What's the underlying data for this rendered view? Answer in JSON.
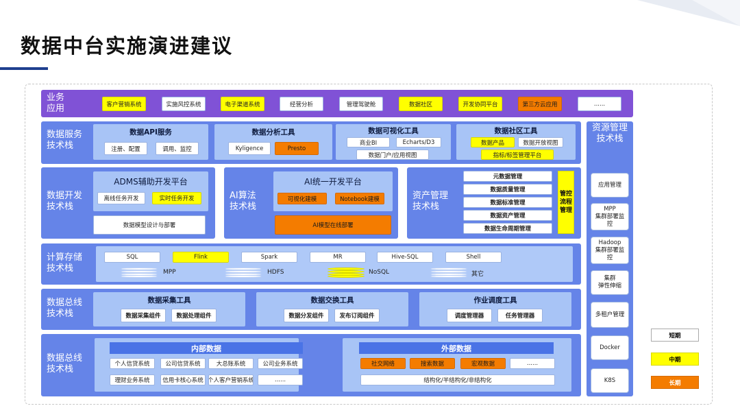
{
  "title": "数据中台实施演进建议",
  "colors": {
    "band": "#6584e8",
    "purple": "#8052d6",
    "inner": "#a8c4f6",
    "yellow": "#ffff00",
    "orange": "#f47c00",
    "bar": "#4a73e6"
  },
  "app_layer": {
    "label": "业务\n应用",
    "chips": [
      "客户营销系统",
      "实施风控系统",
      "电子渠道系统",
      "经营分析",
      "管理驾驶舱",
      "数据社区",
      "开发协同平台",
      "第三方云应用",
      "......"
    ]
  },
  "service_layer": {
    "label": "数据服务\n技术栈",
    "groups": [
      {
        "title": "数据API服务",
        "chips": [
          "注册、配置",
          "调用、监控"
        ]
      },
      {
        "title": "数据分析工具",
        "chips": [
          "Kyligence",
          "Presto"
        ]
      },
      {
        "title": "数据可视化工具",
        "chips": [
          "商业BI",
          "Echarts/D3",
          "数据门户/应用视图"
        ]
      },
      {
        "title": "数据社区工具",
        "chips": [
          "数据产品",
          "数据开放视图",
          "指标/标签管理平台"
        ]
      }
    ]
  },
  "resource": {
    "label": "资源管理\n技术栈",
    "chips": [
      "应用管理",
      "MPP\n集群部署监控",
      "Hadoop\n集群部署监控",
      "集群\n弹性伸缩",
      "多租户管理",
      "Docker",
      "K8S"
    ]
  },
  "dev_layer": {
    "label": "数据开发\n技术栈",
    "adms": {
      "title": "ADMS辅助开发平台",
      "chips": [
        "离线任务开发",
        "实时任务开发",
        "数据模型设计与部署"
      ]
    },
    "ai_label": "AI算法\n技术栈",
    "ai": {
      "title": "AI统一开发平台",
      "chips": [
        "可视化建模",
        "Notebook建模",
        "AI模型在线部署"
      ]
    },
    "asset_label": "资产管理\n技术栈",
    "asset_chips": [
      "元数据管理",
      "数据质量管理",
      "数据标准管理",
      "数据资产管理",
      "数据生命周期管理"
    ],
    "governance": "管控流程管理"
  },
  "compute_layer": {
    "label": "计算存储\n技术栈",
    "chips": [
      "SQL",
      "Flink",
      "Spark",
      "MR",
      "Hive-SQL",
      "Shell"
    ],
    "stores": [
      "MPP",
      "HDFS",
      "NoSQL",
      "其它"
    ]
  },
  "bus_layer": {
    "label": "数据总线\n技术栈",
    "groups": [
      {
        "title": "数据采集工具",
        "chips": [
          "数据采集组件",
          "数据处理组件"
        ]
      },
      {
        "title": "数据交换工具",
        "chips": [
          "数据分发组件",
          "发布订阅组件"
        ]
      },
      {
        "title": "作业调度工具",
        "chips": [
          "调度管理器",
          "任务管理器"
        ]
      }
    ]
  },
  "source_layer": {
    "label": "数据总线\n技术栈",
    "internal": {
      "title": "内部数据",
      "chips": [
        "个人信贷系统",
        "公司信贷系统",
        "大总账系统",
        "公司业务系统",
        "理财业务系统",
        "信用卡核心系统",
        "个人客户营销系统",
        "......"
      ]
    },
    "external": {
      "title": "外部数据",
      "chips": [
        "社交网络",
        "搜索数据",
        "宏观数据",
        "......",
        "结构化/半结构化/非结构化"
      ]
    }
  },
  "legend": {
    "short": "短期",
    "mid": "中期",
    "long": "长期"
  }
}
